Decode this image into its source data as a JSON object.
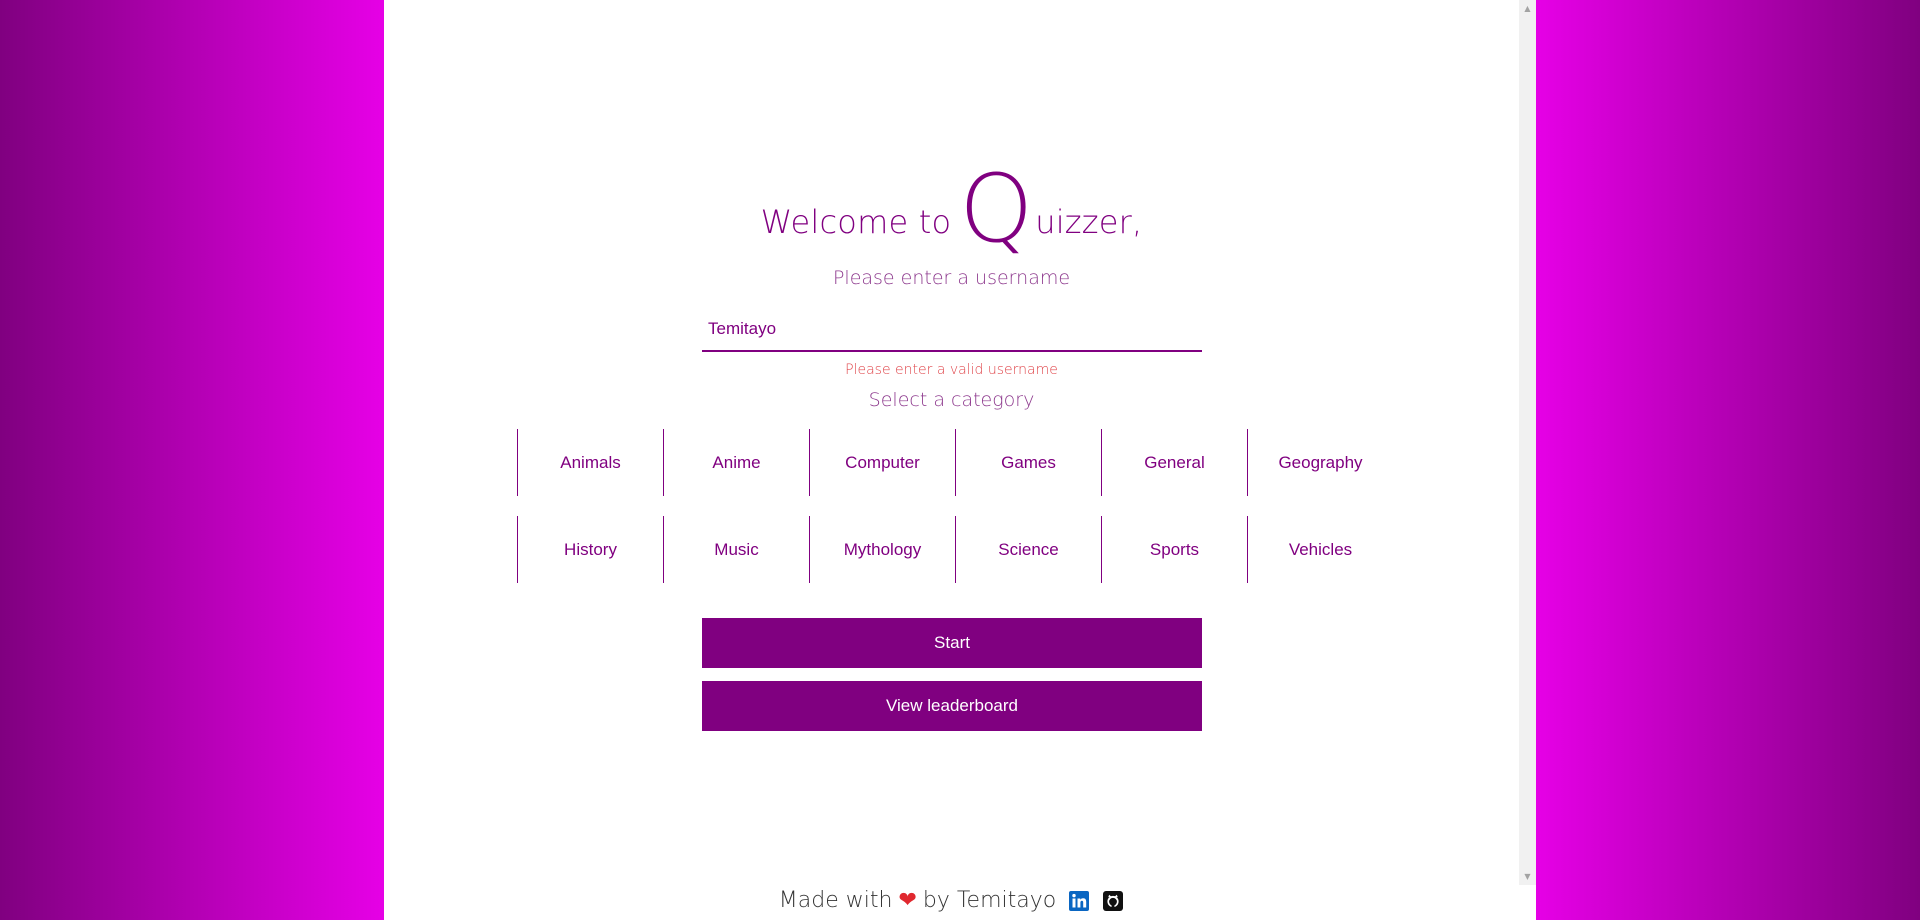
{
  "title": {
    "prefix": "Welcome to",
    "big_letter": "Q",
    "suffix": "uizzer,"
  },
  "subtitle": "Please enter a username",
  "username_input": {
    "value": "Temitayo",
    "placeholder": ""
  },
  "error_message": "Please enter a valid username",
  "category_label": "Select a category",
  "categories": [
    "Animals",
    "Anime",
    "Computer",
    "Games",
    "General",
    "Geography",
    "History",
    "Music",
    "Mythology",
    "Science",
    "Sports",
    "Vehicles"
  ],
  "buttons": {
    "start": "Start",
    "leaderboard": "View leaderboard"
  },
  "footer": {
    "made_with": "Made with",
    "by": "by Temitayo",
    "icons": [
      "heart-icon",
      "linkedin-icon",
      "github-icon"
    ]
  },
  "colors": {
    "accent": "#800080",
    "gradient_light": "#e600e6",
    "error": "#e0474c",
    "heart": "#e0282f"
  }
}
